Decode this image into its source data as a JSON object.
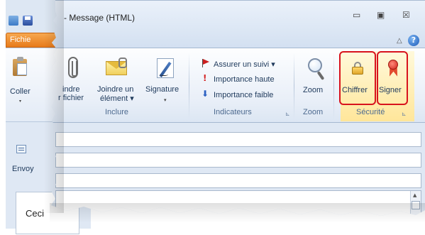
{
  "window": {
    "title": "- Message (HTML)",
    "min_glyph": "▭",
    "max_glyph": "▣",
    "close_glyph": "☒",
    "help_glyph": "?",
    "collapse_glyph": "△"
  },
  "left": {
    "file_tab": "Fichie",
    "paste_label": "Coller",
    "paste_arrow": "▾",
    "send_label": "Envoy",
    "compose_text": "Ceci"
  },
  "ribbon": {
    "include": {
      "attach_file": {
        "line1": "indre",
        "line2": "r fichier"
      },
      "attach_item": {
        "line1": "Joindre un",
        "line2": "élément ▾"
      },
      "signature": {
        "line1": "Signature",
        "arrow": "▾"
      },
      "group_label": "Inclure"
    },
    "indicators": {
      "follow_up": "Assurer un suivi ▾",
      "high_importance": "Importance haute",
      "low_importance": "Importance faible",
      "group_label": "Indicateurs",
      "launcher": "⊾"
    },
    "zoom": {
      "button": "Zoom",
      "group_label": "Zoom"
    },
    "security": {
      "encrypt": "Chiffrer",
      "sign": "Signer",
      "group_label": "Sécurité",
      "launcher": "⊾"
    }
  },
  "colors": {
    "highlight": "#d8131d",
    "security_bg": "#ffe69a",
    "file_tab": "#e77b1b"
  }
}
